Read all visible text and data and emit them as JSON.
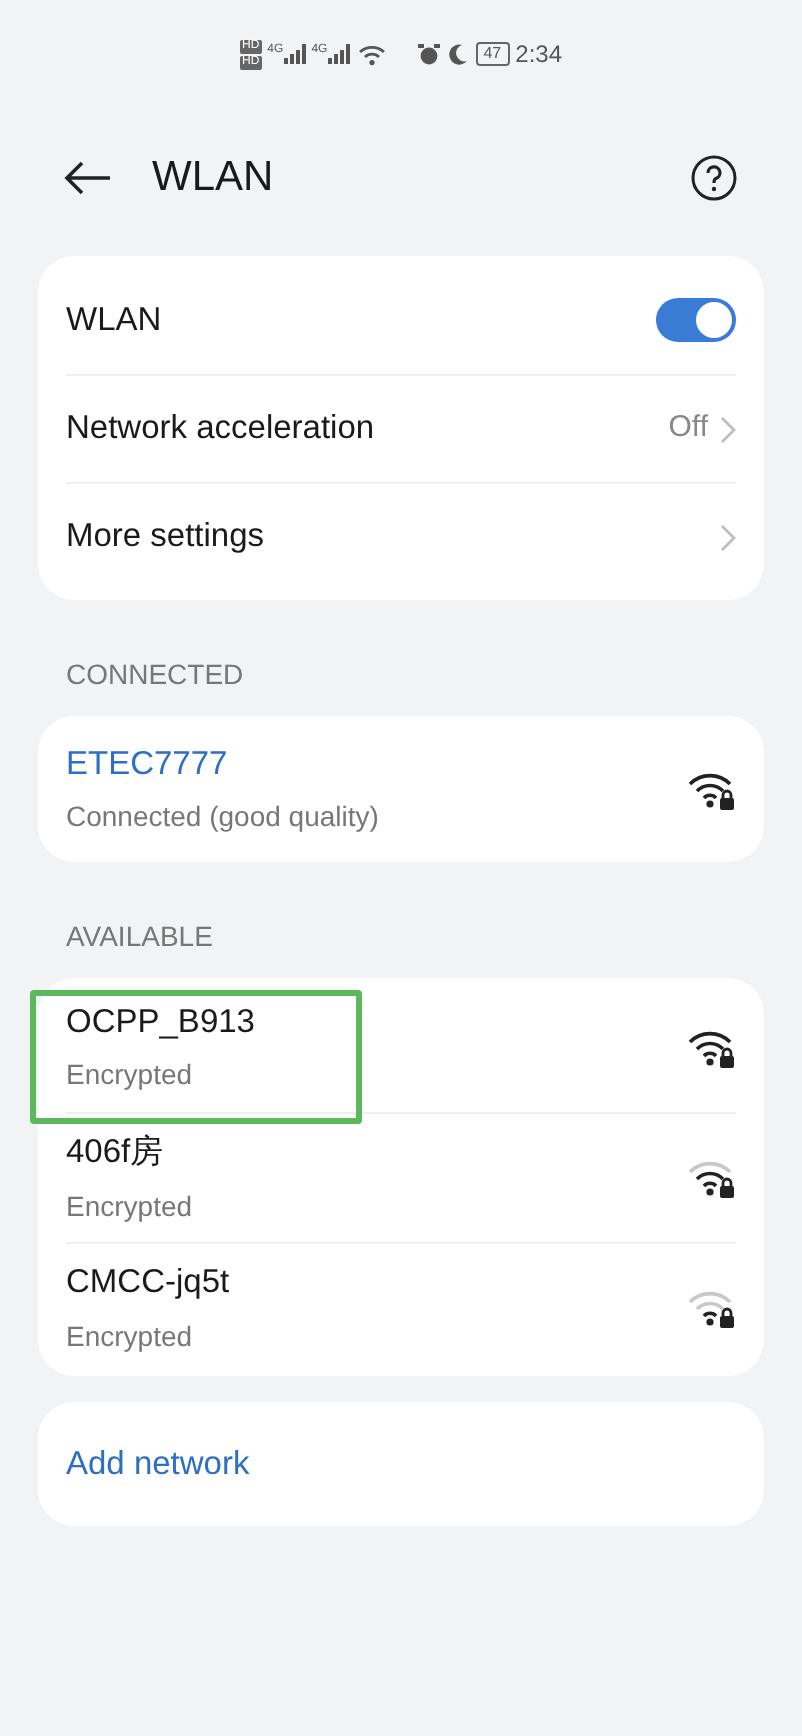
{
  "status_bar": {
    "sim_badges": [
      "HD",
      "HD"
    ],
    "network_types": [
      "4G",
      "4G"
    ],
    "battery": "47",
    "time": "2:34"
  },
  "header": {
    "title": "WLAN"
  },
  "settings": [
    {
      "kind": "toggle",
      "label": "WLAN",
      "on": true
    },
    {
      "kind": "link",
      "label": "Network acceleration",
      "value": "Off"
    },
    {
      "kind": "link",
      "label": "More settings"
    }
  ],
  "connected": {
    "heading": "CONNECTED",
    "network": {
      "name": "ETEC7777",
      "status": "Connected (good quality)",
      "kind": "strong"
    }
  },
  "available": {
    "heading": "AVAILABLE",
    "networks": [
      {
        "name": "OCPP_B913",
        "status": "Encrypted",
        "kind": "strong",
        "highlighted": true
      },
      {
        "name": "406f房",
        "status": "Encrypted",
        "kind": "medium",
        "highlighted": false
      },
      {
        "name": "CMCC-jq5t",
        "status": "Encrypted",
        "kind": "weak",
        "highlighted": false
      }
    ]
  },
  "add_network": "Add network"
}
